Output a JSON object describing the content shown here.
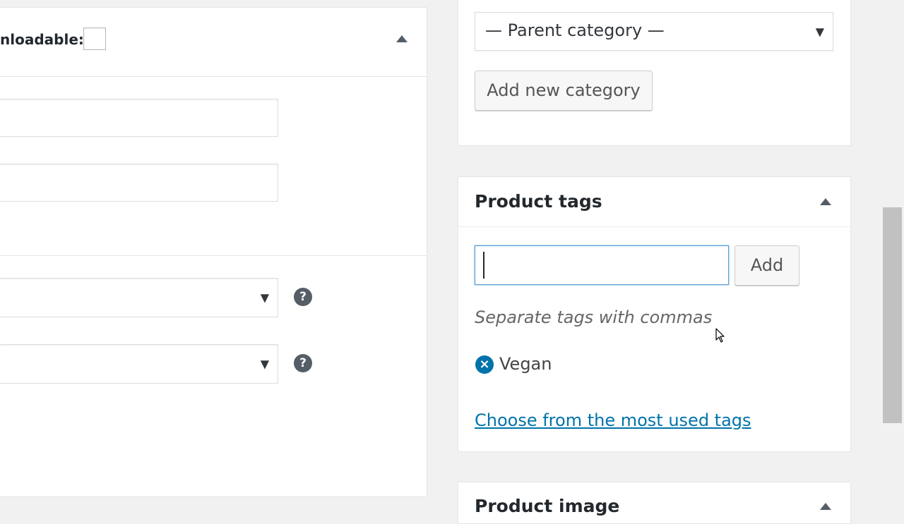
{
  "product_data": {
    "downloadable_label": "nloadable:"
  },
  "category": {
    "parent_select_value": "— Parent category —",
    "add_button_label": "Add new category"
  },
  "product_tags": {
    "title": "Product tags",
    "input_value": "",
    "add_button_label": "Add",
    "howto_text": "Separate tags with commas",
    "tags": [
      {
        "name": "Vegan"
      }
    ],
    "most_used_link": "Choose from the most used tags"
  },
  "product_image": {
    "title": "Product image"
  },
  "icons": {
    "help": "?",
    "remove": "×",
    "select_arrow": "▼"
  },
  "colors": {
    "accent": "#0073aa",
    "focus_border": "#5b9dd9",
    "background": "#f1f1f1"
  }
}
